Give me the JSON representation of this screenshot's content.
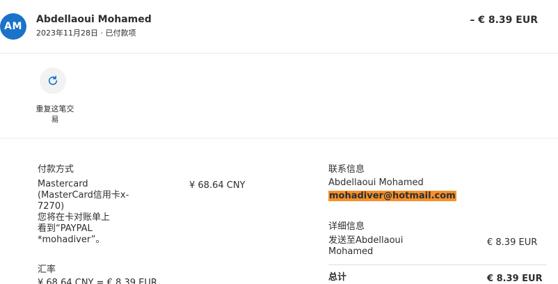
{
  "header": {
    "avatar_initials": "AM",
    "name": "Abdellaoui Mohamed",
    "date_status": "2023年11月28日 · 已付款项",
    "amount": "– € 8.39 EUR"
  },
  "actions": {
    "repeat_label": "重复这笔交易",
    "repeat_icon": "refresh-icon"
  },
  "payment": {
    "label": "付款方式",
    "method_line1": "Mastercard",
    "method_line2": "(MasterCard信用卡x-",
    "method_line3": "7270)",
    "method_line4": "您将在卡对账单上",
    "method_line5": "看到“PAYPAL",
    "method_line6": "*mohadiver”。",
    "method_amount": "¥ 68.64 CNY",
    "exchange_label": "汇率",
    "exchange_value": "¥ 68.64 CNY = € 8.39 EUR"
  },
  "contact": {
    "label": "联系信息",
    "name": "Abdellaoui Mohamed",
    "email": "mohadiver@hotmail.com"
  },
  "details": {
    "label": "详细信息",
    "sent_to_line1": "发送至Abdellaoui",
    "sent_to_line2": "Mohamed",
    "sent_amount": "€ 8.39 EUR",
    "total_label": "总计",
    "total_amount": "€ 8.39 EUR"
  },
  "colors": {
    "avatar_bg": "#1a73c8",
    "email_highlight": "#f5902b",
    "icon_blue": "#1a73c8"
  }
}
